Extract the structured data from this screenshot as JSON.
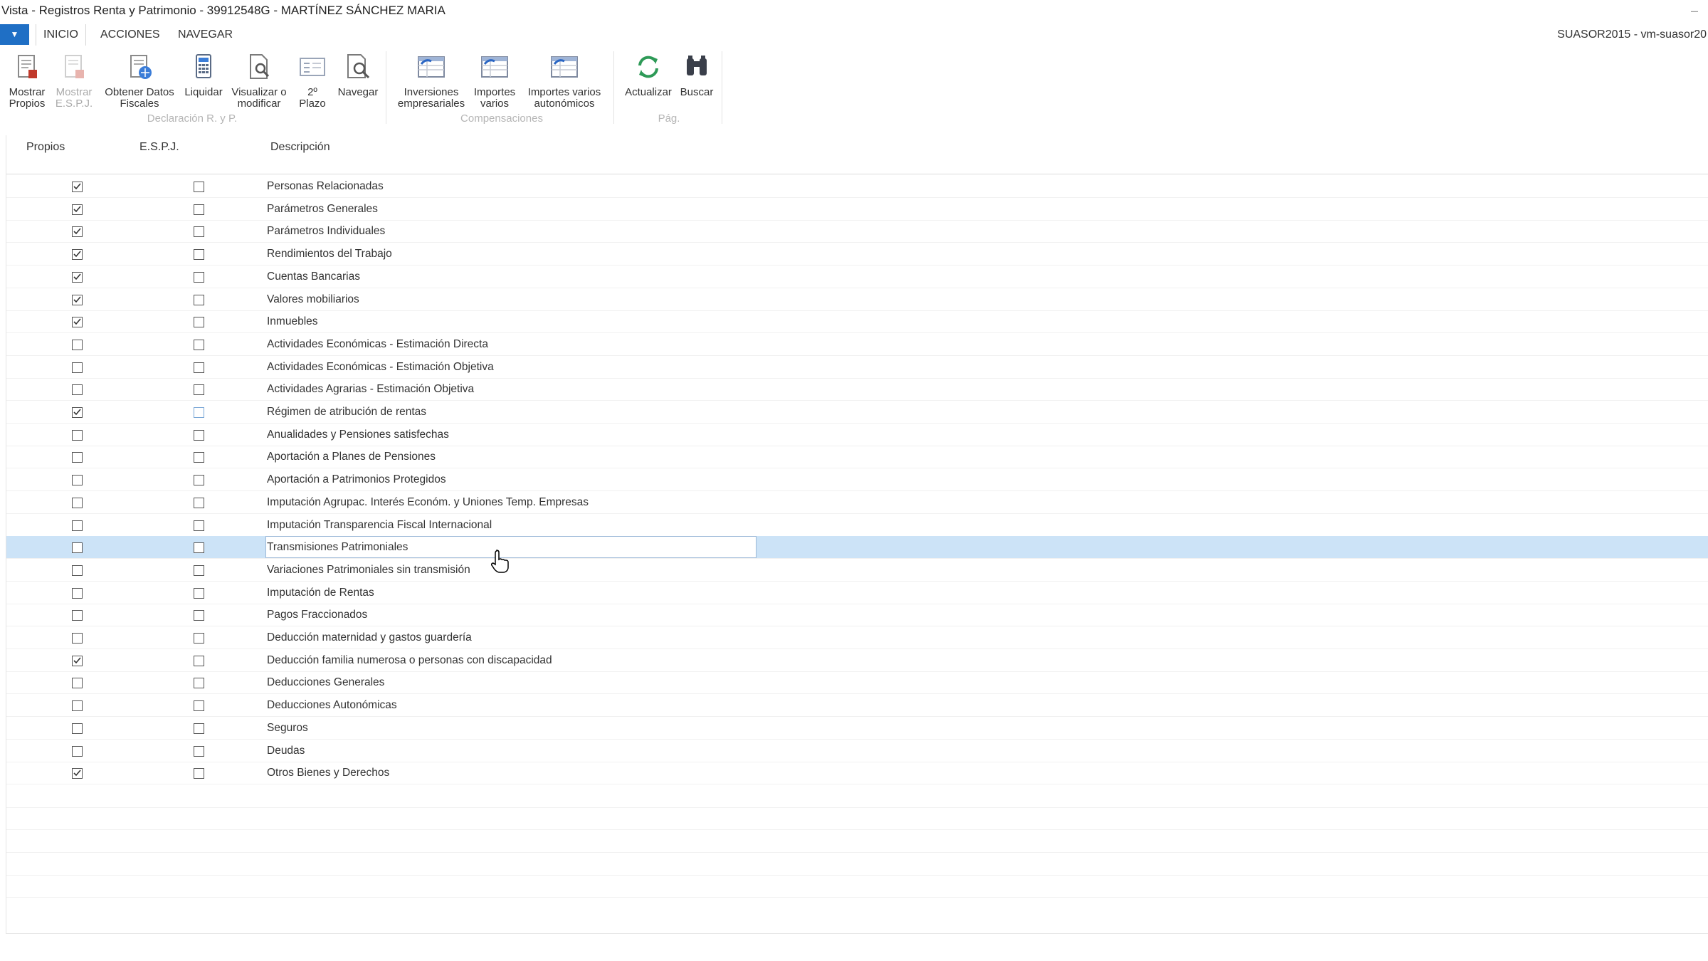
{
  "window": {
    "title": "Vista - Registros Renta y Patrimonio - 39912548G - MARTÍNEZ SÁNCHEZ MARIA",
    "server": "SUASOR2015 - vm-suasor20"
  },
  "tabs": [
    "INICIO",
    "ACCIONES",
    "NAVEGAR"
  ],
  "ribbon": {
    "groups": [
      {
        "label": "Declaración R. y P."
      },
      {
        "label": "Compensaciones"
      },
      {
        "label": "Pág."
      }
    ],
    "buttons": [
      {
        "label1": "Mostrar",
        "label2": "Propios",
        "icon": "show-own-icon",
        "disabled": false
      },
      {
        "label1": "Mostrar",
        "label2": "E.S.P.J.",
        "icon": "show-espj-icon",
        "disabled": true
      },
      {
        "label1": "Obtener Datos",
        "label2": "Fiscales",
        "icon": "fiscal-data-icon",
        "disabled": false
      },
      {
        "label1": "Liquidar",
        "label2": "",
        "icon": "calculator-icon",
        "disabled": false
      },
      {
        "label1": "Visualizar o",
        "label2": "modificar",
        "icon": "view-modify-icon",
        "disabled": false
      },
      {
        "label1": "2º",
        "label2": "Plazo",
        "icon": "second-term-icon",
        "disabled": false
      },
      {
        "label1": "Navegar",
        "label2": "",
        "icon": "navigate-icon",
        "disabled": false
      },
      {
        "label1": "Inversiones",
        "label2": "empresariales",
        "icon": "business-investments-icon",
        "disabled": false
      },
      {
        "label1": "Importes",
        "label2": "varios",
        "icon": "various-amounts-icon",
        "disabled": false
      },
      {
        "label1": "Importes varios",
        "label2": "autonómicos",
        "icon": "regional-amounts-icon",
        "disabled": false
      },
      {
        "label1": "Actualizar",
        "label2": "",
        "icon": "refresh-icon",
        "disabled": false
      },
      {
        "label1": "Buscar",
        "label2": "",
        "icon": "binoculars-icon",
        "disabled": false
      }
    ]
  },
  "grid": {
    "headers": {
      "own": "Propios",
      "espj": "E.S.P.J.",
      "desc": "Descripción"
    },
    "rows": [
      {
        "desc": "Personas Relacionadas",
        "own": true,
        "espj": false
      },
      {
        "desc": "Parámetros Generales",
        "own": true,
        "espj": false
      },
      {
        "desc": "Parámetros Individuales",
        "own": true,
        "espj": false
      },
      {
        "desc": "Rendimientos del Trabajo",
        "own": true,
        "espj": false
      },
      {
        "desc": "Cuentas Bancarias",
        "own": true,
        "espj": false
      },
      {
        "desc": "Valores mobiliarios",
        "own": true,
        "espj": false
      },
      {
        "desc": "Inmuebles",
        "own": true,
        "espj": false
      },
      {
        "desc": "Actividades Económicas - Estimación Directa",
        "own": false,
        "espj": false
      },
      {
        "desc": "Actividades Económicas - Estimación Objetiva",
        "own": false,
        "espj": false
      },
      {
        "desc": "Actividades Agrarias - Estimación Objetiva",
        "own": false,
        "espj": false
      },
      {
        "desc": "Régimen de atribución de rentas",
        "own": true,
        "espj": false,
        "light": true
      },
      {
        "desc": "Anualidades y Pensiones satisfechas",
        "own": false,
        "espj": false
      },
      {
        "desc": "Aportación a Planes de Pensiones",
        "own": false,
        "espj": false
      },
      {
        "desc": "Aportación a Patrimonios Protegidos",
        "own": false,
        "espj": false
      },
      {
        "desc": "Imputación Agrupac. Interés Económ. y Uniones Temp. Empresas",
        "own": false,
        "espj": false
      },
      {
        "desc": "Imputación Transparencia Fiscal Internacional",
        "own": false,
        "espj": false
      },
      {
        "desc": "Transmisiones Patrimoniales",
        "own": false,
        "espj": false,
        "selected": true
      },
      {
        "desc": "Variaciones Patrimoniales sin transmisión",
        "own": false,
        "espj": false
      },
      {
        "desc": "Imputación de Rentas",
        "own": false,
        "espj": false
      },
      {
        "desc": "Pagos Fraccionados",
        "own": false,
        "espj": false
      },
      {
        "desc": "Deducción maternidad y gastos guardería",
        "own": false,
        "espj": false
      },
      {
        "desc": "Deducción familia numerosa o personas con discapacidad",
        "own": true,
        "espj": false
      },
      {
        "desc": "Deducciones Generales",
        "own": false,
        "espj": false
      },
      {
        "desc": "Deducciones Autonómicas",
        "own": false,
        "espj": false
      },
      {
        "desc": "Seguros",
        "own": false,
        "espj": false
      },
      {
        "desc": "Deudas",
        "own": false,
        "espj": false
      },
      {
        "desc": "Otros Bienes y Derechos",
        "own": true,
        "espj": false
      }
    ]
  },
  "colors": {
    "accent": "#1f6fc5",
    "selection": "#cce3f7"
  }
}
